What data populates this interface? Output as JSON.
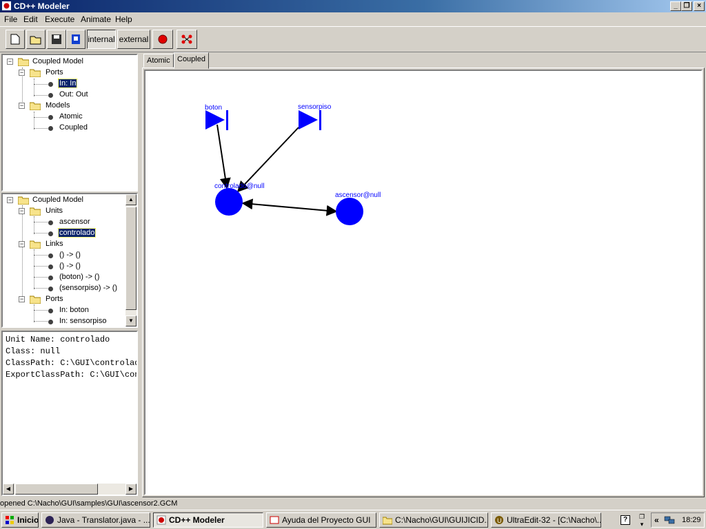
{
  "window": {
    "title": "CD++ Modeler"
  },
  "menu": [
    "File",
    "Edit",
    "Execute",
    "Animate",
    "Help"
  ],
  "toolbar": {
    "internal_label": "internal",
    "external_label": "external"
  },
  "tree_top": {
    "root": "Coupled Model",
    "ports_folder": "Ports",
    "port_in": "In: In",
    "port_out": "Out: Out",
    "models_folder": "Models",
    "model_atomic": "Atomic",
    "model_coupled": "Coupled"
  },
  "tree_bottom": {
    "root": "Coupled Model",
    "units_folder": "Units",
    "unit_1": "ascensor",
    "unit_2": "controlado",
    "links_folder": "Links",
    "link_1": "() -> ()",
    "link_2": "() -> ()",
    "link_3": "(boton) -> ()",
    "link_4": "(sensorpiso) -> ()",
    "ports_folder": "Ports",
    "port_1": "In: boton",
    "port_2": "In: sensorpiso"
  },
  "info": {
    "line1": "Unit Name: controlado",
    "line2": "Class: null",
    "line3": "ClassPath: C:\\GUI\\controlado",
    "line4": "ExportClassPath: C:\\GUI\\cont"
  },
  "tabs": [
    "Atomic",
    "Coupled"
  ],
  "diagram": {
    "port_boton": "boton",
    "port_sensorpiso": "sensorpiso",
    "unit_controlado": "controlado@null",
    "unit_ascensor": "ascensor@null",
    "color": "#0000ff"
  },
  "status": {
    "text": "opened C:\\Nacho\\GUI\\samples\\GUI\\ascensor2.GCM"
  },
  "taskbar": {
    "start": "Inicio",
    "tasks": [
      "Java - Translator.java - ...",
      "CD++ Modeler",
      "Ayuda del Proyecto GUI",
      "C:\\Nacho\\GUI\\GUIJICID...",
      "UltraEdit-32 - [C:\\Nacho\\..."
    ],
    "clock": "18:29"
  }
}
